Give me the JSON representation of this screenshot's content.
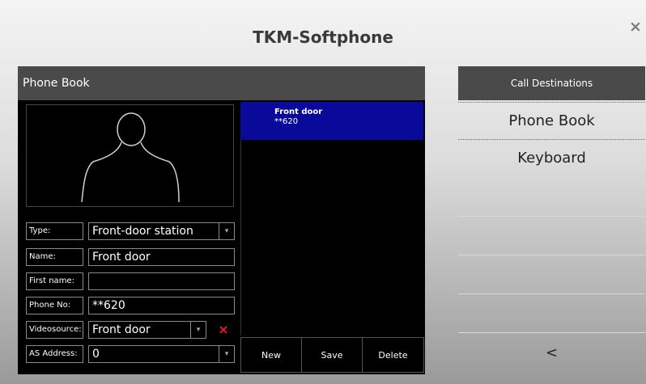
{
  "app": {
    "title": "TKM-Softphone",
    "close_label": "×"
  },
  "phone_book": {
    "header": "Phone Book",
    "fields": {
      "type_label": "Type:",
      "type_value": "Front-door station",
      "name_label": "Name:",
      "name_value": "Front door",
      "first_name_label": "First name:",
      "first_name_value": "",
      "phone_label": "Phone No:",
      "phone_value": "**620",
      "video_label": "Videosource:",
      "video_value": "Front door",
      "as_label": "AS Address:",
      "as_value": "0"
    },
    "delete_icon": "×",
    "dropdown_icon": "▾",
    "contacts": [
      {
        "name": "Front door",
        "number": "**620"
      }
    ],
    "buttons": {
      "new": "New",
      "save": "Save",
      "delete": "Delete"
    }
  },
  "destinations": {
    "header": "Call Destinations",
    "items": [
      "Phone Book",
      "Keyboard",
      "",
      "",
      "",
      ""
    ],
    "back_label": "<"
  }
}
